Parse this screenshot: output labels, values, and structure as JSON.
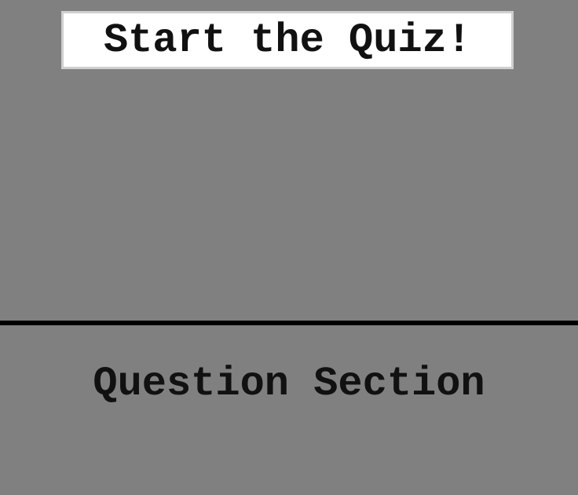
{
  "quiz": {
    "start_button_label": "Start the Quiz!"
  },
  "question_section": {
    "heading": "Question Section"
  },
  "colors": {
    "background": "#808080",
    "button_background": "#ffffff",
    "button_border": "#cfcfcf",
    "divider": "#000000",
    "text": "#111111"
  }
}
